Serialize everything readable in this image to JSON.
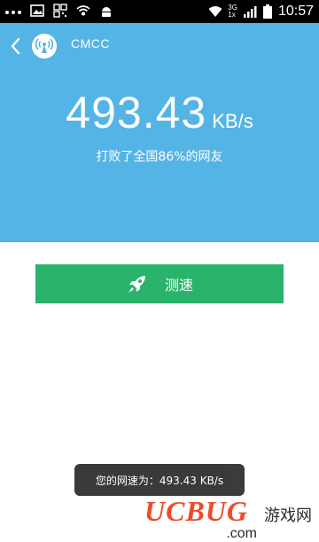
{
  "status_bar": {
    "net_type_top": "3G",
    "net_type_bottom": "1x",
    "time": "10:57"
  },
  "header": {
    "network_name": "CMCC"
  },
  "result": {
    "speed_value": "493.43",
    "speed_unit": "KB/s",
    "rank_text": "打败了全国86%的网友"
  },
  "actions": {
    "speed_test_label": "测速"
  },
  "toast": {
    "message": "您的网速为：493.43 KB/s"
  },
  "watermark": {
    "brand": "UCBUG",
    "cn": "游戏网",
    "domain": ".com"
  },
  "colors": {
    "hero_bg": "#54b4e6",
    "button_bg": "#2bb36b",
    "toast_bg": "#303030"
  },
  "icons": [
    "back-icon",
    "signal-tower-icon",
    "rocket-icon",
    "wifi-icon",
    "battery-icon"
  ]
}
